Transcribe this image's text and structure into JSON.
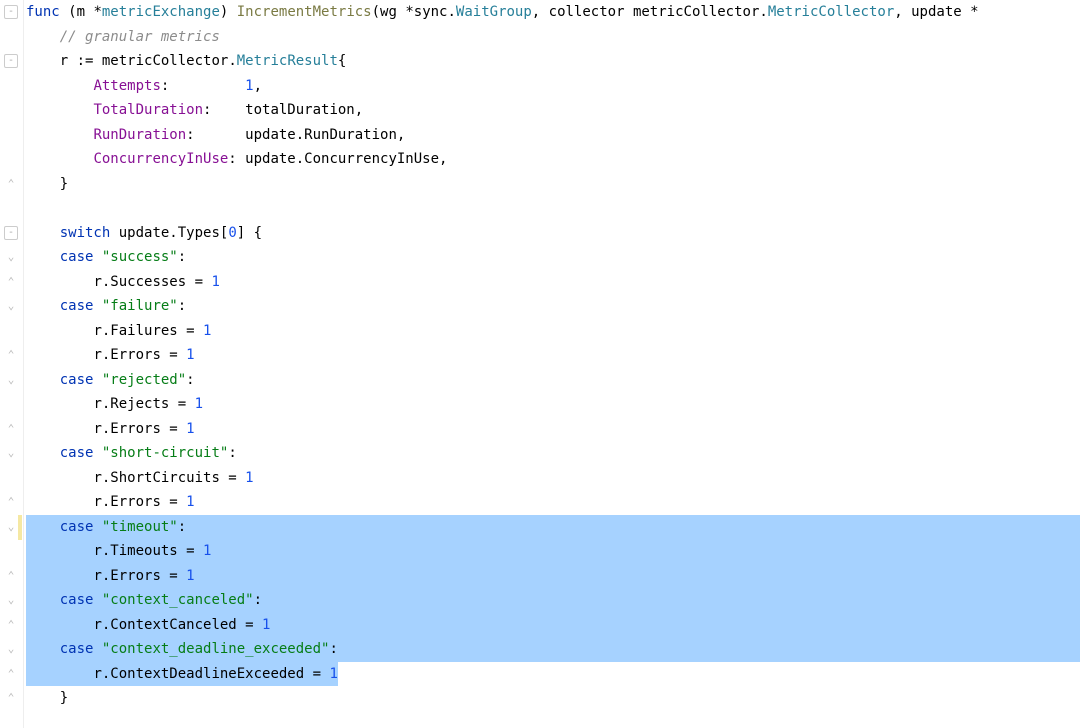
{
  "code": {
    "lines": [
      {
        "indent": 0,
        "segs": [
          {
            "t": "func ",
            "c": "kw"
          },
          {
            "t": "(m *",
            "c": "punc"
          },
          {
            "t": "metricExchange",
            "c": "type"
          },
          {
            "t": ") ",
            "c": "punc"
          },
          {
            "t": "IncrementMetrics",
            "c": "call"
          },
          {
            "t": "(wg *",
            "c": "punc"
          },
          {
            "t": "sync",
            "c": "pkg"
          },
          {
            "t": ".",
            "c": "punc"
          },
          {
            "t": "WaitGroup",
            "c": "type"
          },
          {
            "t": ", collector ",
            "c": "punc"
          },
          {
            "t": "metricCollector",
            "c": "pkg"
          },
          {
            "t": ".",
            "c": "punc"
          },
          {
            "t": "MetricCollector",
            "c": "type"
          },
          {
            "t": ", update *",
            "c": "punc"
          }
        ],
        "sel": false
      },
      {
        "indent": 1,
        "segs": [
          {
            "t": "// granular metrics",
            "c": "cmt"
          }
        ],
        "sel": false
      },
      {
        "indent": 1,
        "segs": [
          {
            "t": "r := ",
            "c": "id"
          },
          {
            "t": "metricCollector",
            "c": "pkg"
          },
          {
            "t": ".",
            "c": "punc"
          },
          {
            "t": "MetricResult",
            "c": "type"
          },
          {
            "t": "{",
            "c": "punc"
          }
        ],
        "sel": false
      },
      {
        "indent": 2,
        "segs": [
          {
            "t": "Attempts",
            "c": "field"
          },
          {
            "t": ":         ",
            "c": "punc"
          },
          {
            "t": "1",
            "c": "num"
          },
          {
            "t": ",",
            "c": "punc"
          }
        ],
        "sel": false
      },
      {
        "indent": 2,
        "segs": [
          {
            "t": "TotalDuration",
            "c": "field"
          },
          {
            "t": ":    totalDuration,",
            "c": "punc"
          }
        ],
        "sel": false
      },
      {
        "indent": 2,
        "segs": [
          {
            "t": "RunDuration",
            "c": "field"
          },
          {
            "t": ":      update.RunDuration,",
            "c": "punc"
          }
        ],
        "sel": false
      },
      {
        "indent": 2,
        "segs": [
          {
            "t": "ConcurrencyInUse",
            "c": "field"
          },
          {
            "t": ": update.ConcurrencyInUse,",
            "c": "punc"
          }
        ],
        "sel": false
      },
      {
        "indent": 1,
        "segs": [
          {
            "t": "}",
            "c": "punc"
          }
        ],
        "sel": false
      },
      {
        "indent": 0,
        "segs": [
          {
            "t": "",
            "c": "punc"
          }
        ],
        "sel": false
      },
      {
        "indent": 1,
        "segs": [
          {
            "t": "switch ",
            "c": "kw"
          },
          {
            "t": "update.Types[",
            "c": "id"
          },
          {
            "t": "0",
            "c": "num"
          },
          {
            "t": "] {",
            "c": "punc"
          }
        ],
        "sel": false
      },
      {
        "indent": 1,
        "segs": [
          {
            "t": "case ",
            "c": "kw"
          },
          {
            "t": "\"success\"",
            "c": "str"
          },
          {
            "t": ":",
            "c": "punc"
          }
        ],
        "sel": false
      },
      {
        "indent": 2,
        "segs": [
          {
            "t": "r.Successes = ",
            "c": "id"
          },
          {
            "t": "1",
            "c": "num"
          }
        ],
        "sel": false
      },
      {
        "indent": 1,
        "segs": [
          {
            "t": "case ",
            "c": "kw"
          },
          {
            "t": "\"failure\"",
            "c": "str"
          },
          {
            "t": ":",
            "c": "punc"
          }
        ],
        "sel": false
      },
      {
        "indent": 2,
        "segs": [
          {
            "t": "r.Failures = ",
            "c": "id"
          },
          {
            "t": "1",
            "c": "num"
          }
        ],
        "sel": false
      },
      {
        "indent": 2,
        "segs": [
          {
            "t": "r.Errors = ",
            "c": "id"
          },
          {
            "t": "1",
            "c": "num"
          }
        ],
        "sel": false
      },
      {
        "indent": 1,
        "segs": [
          {
            "t": "case ",
            "c": "kw"
          },
          {
            "t": "\"rejected\"",
            "c": "str"
          },
          {
            "t": ":",
            "c": "punc"
          }
        ],
        "sel": false
      },
      {
        "indent": 2,
        "segs": [
          {
            "t": "r.Rejects = ",
            "c": "id"
          },
          {
            "t": "1",
            "c": "num"
          }
        ],
        "sel": false
      },
      {
        "indent": 2,
        "segs": [
          {
            "t": "r.Errors = ",
            "c": "id"
          },
          {
            "t": "1",
            "c": "num"
          }
        ],
        "sel": false
      },
      {
        "indent": 1,
        "segs": [
          {
            "t": "case ",
            "c": "kw"
          },
          {
            "t": "\"short-circuit\"",
            "c": "str"
          },
          {
            "t": ":",
            "c": "punc"
          }
        ],
        "sel": false
      },
      {
        "indent": 2,
        "segs": [
          {
            "t": "r.ShortCircuits = ",
            "c": "id"
          },
          {
            "t": "1",
            "c": "num"
          }
        ],
        "sel": false
      },
      {
        "indent": 2,
        "segs": [
          {
            "t": "r.Errors = ",
            "c": "id"
          },
          {
            "t": "1",
            "c": "num"
          }
        ],
        "sel": false
      },
      {
        "indent": 1,
        "segs": [
          {
            "t": "case ",
            "c": "kw"
          },
          {
            "t": "\"timeout\"",
            "c": "str"
          },
          {
            "t": ":",
            "c": "punc"
          }
        ],
        "sel": true
      },
      {
        "indent": 2,
        "segs": [
          {
            "t": "r.Timeouts = ",
            "c": "id"
          },
          {
            "t": "1",
            "c": "num"
          }
        ],
        "sel": true
      },
      {
        "indent": 2,
        "segs": [
          {
            "t": "r.Errors = ",
            "c": "id"
          },
          {
            "t": "1",
            "c": "num"
          }
        ],
        "sel": true
      },
      {
        "indent": 1,
        "segs": [
          {
            "t": "case ",
            "c": "kw"
          },
          {
            "t": "\"context_canceled\"",
            "c": "str"
          },
          {
            "t": ":",
            "c": "punc"
          }
        ],
        "sel": true
      },
      {
        "indent": 2,
        "segs": [
          {
            "t": "r.ContextCanceled = ",
            "c": "id"
          },
          {
            "t": "1",
            "c": "num"
          }
        ],
        "sel": true
      },
      {
        "indent": 1,
        "segs": [
          {
            "t": "case ",
            "c": "kw"
          },
          {
            "t": "\"context_deadline_exceeded\"",
            "c": "str"
          },
          {
            "t": ":",
            "c": "punc"
          }
        ],
        "sel": true
      },
      {
        "indent": 2,
        "segs": [
          {
            "t": "r.ContextDeadlineExceeded = ",
            "c": "id"
          },
          {
            "t": "1",
            "c": "num"
          }
        ],
        "sel": "last"
      },
      {
        "indent": 1,
        "segs": [
          {
            "t": "}",
            "c": "punc"
          }
        ],
        "sel": false
      }
    ]
  },
  "gutter": {
    "marks": [
      {
        "row": 0,
        "type": "fold",
        "sym": "-"
      },
      {
        "row": 2,
        "type": "fold",
        "sym": "-"
      },
      {
        "row": 7,
        "type": "bracket",
        "sym": "⌃"
      },
      {
        "row": 9,
        "type": "fold",
        "sym": "-"
      },
      {
        "row": 10,
        "type": "bracket",
        "sym": "⌄"
      },
      {
        "row": 11,
        "type": "bracket",
        "sym": "⌃"
      },
      {
        "row": 12,
        "type": "bracket",
        "sym": "⌄"
      },
      {
        "row": 14,
        "type": "bracket",
        "sym": "⌃"
      },
      {
        "row": 15,
        "type": "bracket",
        "sym": "⌄"
      },
      {
        "row": 17,
        "type": "bracket",
        "sym": "⌃"
      },
      {
        "row": 18,
        "type": "bracket",
        "sym": "⌄"
      },
      {
        "row": 20,
        "type": "bracket",
        "sym": "⌃"
      },
      {
        "row": 21,
        "type": "bracket",
        "sym": "⌄"
      },
      {
        "row": 23,
        "type": "bracket",
        "sym": "⌃"
      },
      {
        "row": 24,
        "type": "bracket",
        "sym": "⌄"
      },
      {
        "row": 25,
        "type": "bracket",
        "sym": "⌃"
      },
      {
        "row": 26,
        "type": "bracket",
        "sym": "⌄"
      },
      {
        "row": 27,
        "type": "bracket",
        "sym": "⌃"
      },
      {
        "row": 28,
        "type": "bracket",
        "sym": "⌃"
      }
    ],
    "changebar_row": 21
  },
  "indent_unit": "    "
}
